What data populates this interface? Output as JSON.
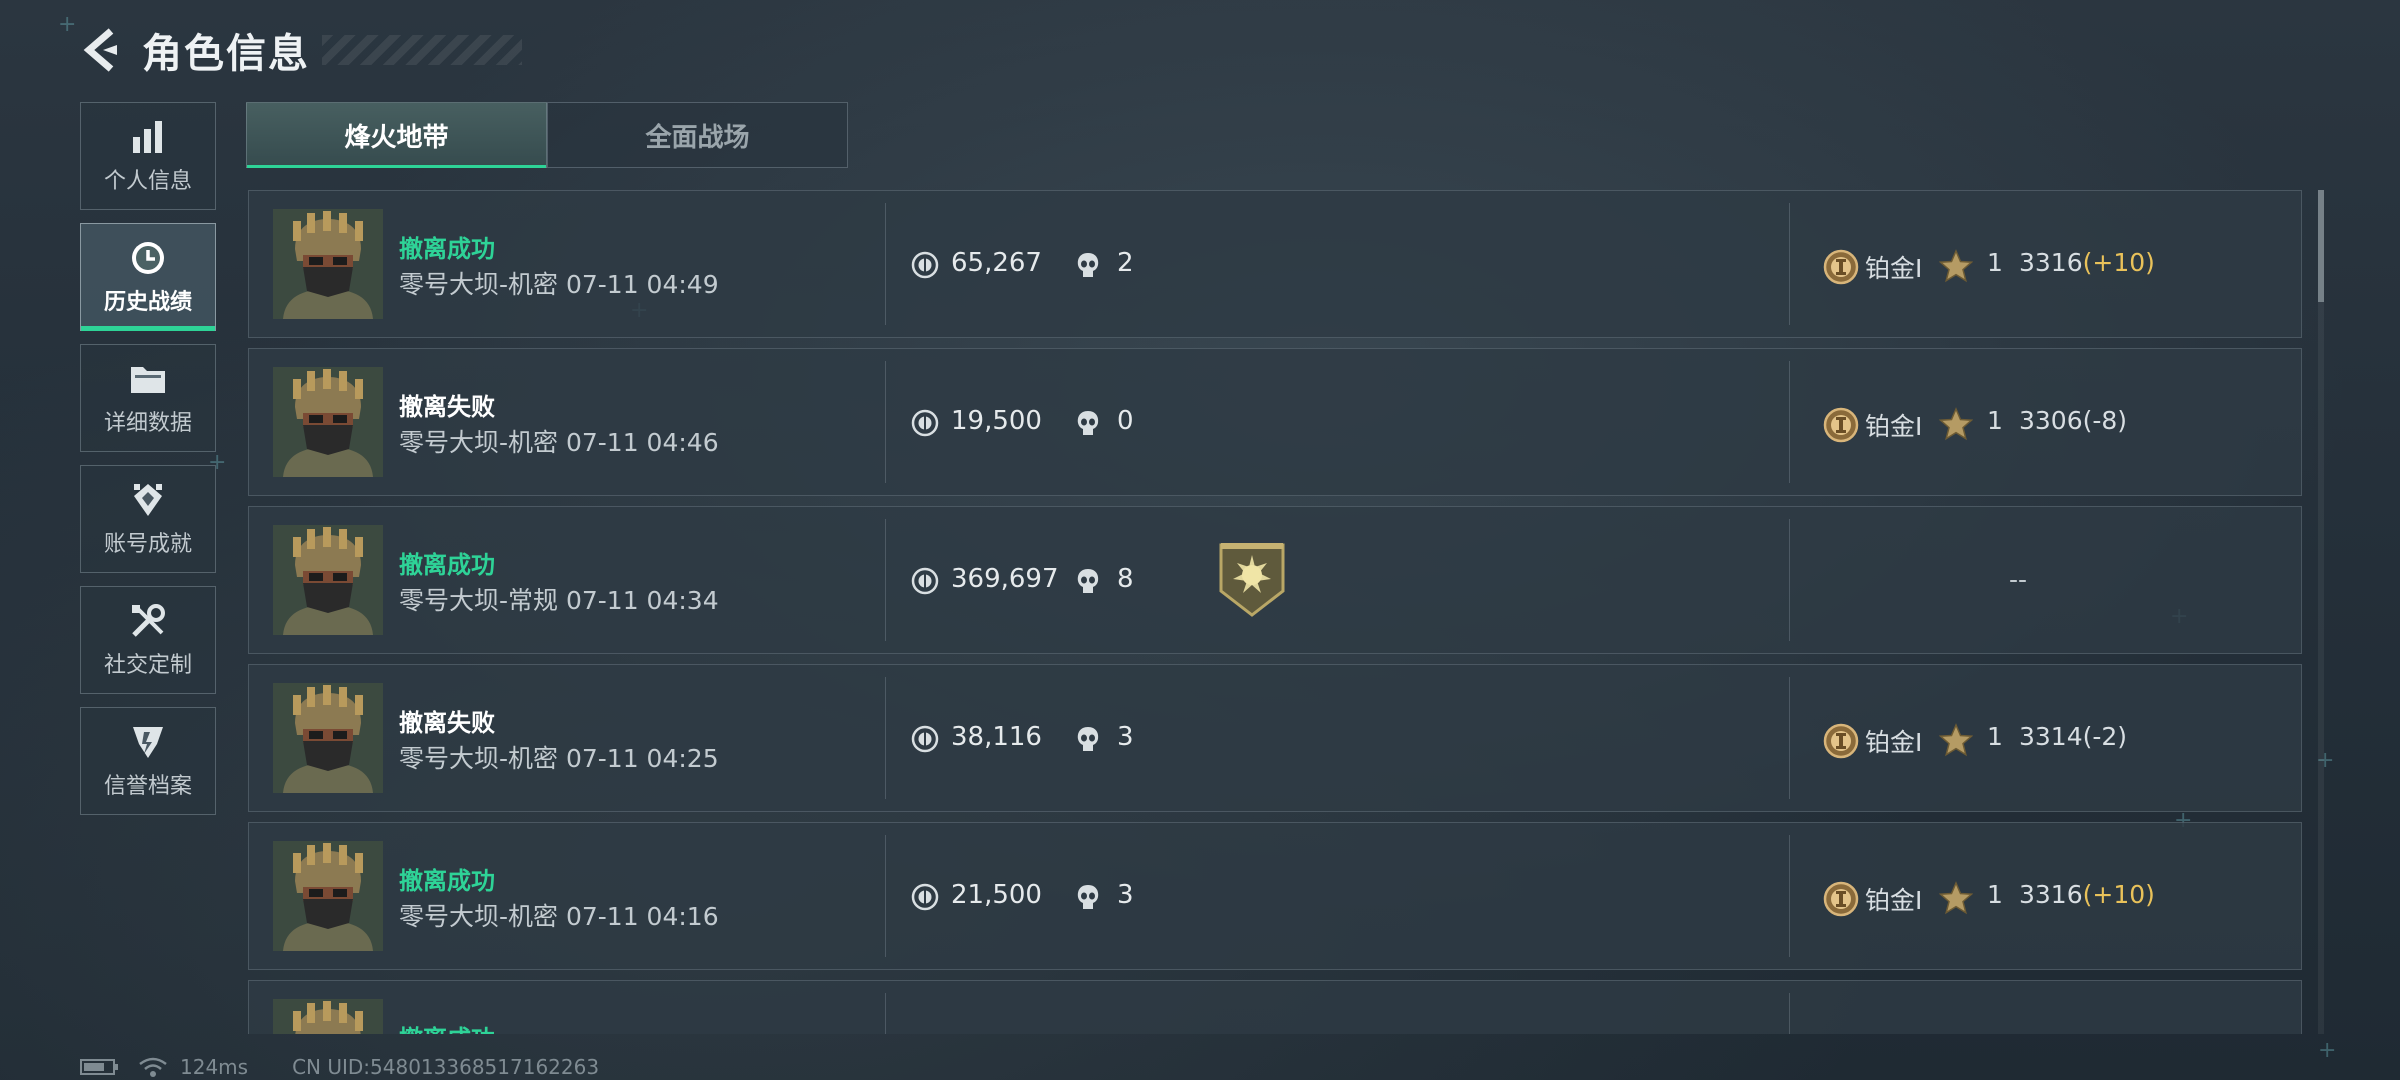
{
  "header": {
    "title": "角色信息"
  },
  "sidebar": {
    "items": [
      {
        "label": "个人信息",
        "icon": "bar-chart-icon"
      },
      {
        "label": "历史战绩",
        "icon": "clock-icon",
        "active": true
      },
      {
        "label": "详细数据",
        "icon": "folder-icon"
      },
      {
        "label": "账号成就",
        "icon": "achievement-icon"
      },
      {
        "label": "社交定制",
        "icon": "tools-icon"
      },
      {
        "label": "信誉档案",
        "icon": "reputation-icon"
      }
    ]
  },
  "tabs": [
    {
      "label": "烽火地带",
      "active": true
    },
    {
      "label": "全面战场",
      "active": false
    }
  ],
  "records": [
    {
      "result": "撤离成功",
      "status": "ok",
      "subtitle": "零号大坝-机密 07-11 04:49",
      "money": "65,267",
      "kills": "2",
      "rank": "铂金I",
      "stars": "1",
      "score": "3316",
      "delta": "(+10)",
      "delta_up": true
    },
    {
      "result": "撤离失败",
      "status": "fail",
      "subtitle": "零号大坝-机密 07-11 04:46",
      "money": "19,500",
      "kills": "0",
      "rank": "铂金I",
      "stars": "1",
      "score": "3306",
      "delta": "(-8)",
      "delta_up": false
    },
    {
      "result": "撤离成功",
      "status": "ok",
      "subtitle": "零号大坝-常规 07-11 04:34",
      "money": "369,697",
      "kills": "8",
      "badge": "emblem-badge-icon",
      "no_rank": "--"
    },
    {
      "result": "撤离失败",
      "status": "fail",
      "subtitle": "零号大坝-机密 07-11 04:25",
      "money": "38,116",
      "kills": "3",
      "rank": "铂金I",
      "stars": "1",
      "score": "3314",
      "delta": "(-2)",
      "delta_up": false
    },
    {
      "result": "撤离成功",
      "status": "ok",
      "subtitle": "零号大坝-机密 07-11 04:16",
      "money": "21,500",
      "kills": "3",
      "rank": "铂金I",
      "stars": "1",
      "score": "3316",
      "delta": "(+10)",
      "delta_up": true
    },
    {
      "result": "撤离成功",
      "status": "ok",
      "subtitle": "",
      "money": "",
      "kills": "",
      "partial": true
    }
  ],
  "footer": {
    "latency": "124ms",
    "uid": "CN UID:548013368517162263"
  },
  "colors": {
    "success": "#2ed397",
    "accent_gold": "#e9c25a",
    "panel": "#2e3a44"
  }
}
